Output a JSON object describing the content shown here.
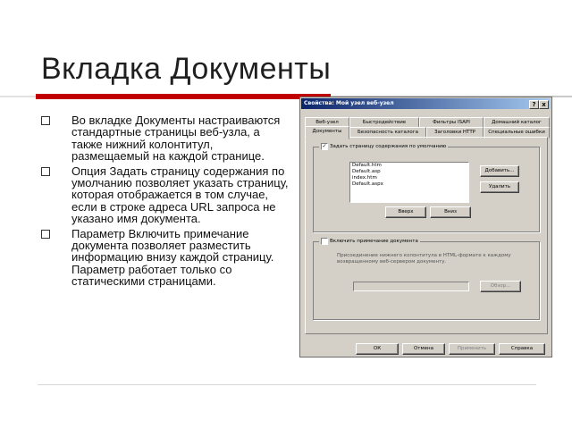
{
  "slide": {
    "title": "Вкладка Документы",
    "bullets": [
      "Во вкладке Документы настраиваются стандартные страницы веб-узла, а также нижний колонтитул, размещаемый на каждой странице.",
      "Опция Задать страницу содержания по умолчанию позволяет указать страницу, которая отображается в том случае, если в строке адреса URL запроса не указано имя документа.",
      "Параметр Включить примечание документа позволяет разместить информацию внизу каждой страницу. Параметр работает только со статическими страницами."
    ]
  },
  "dialog": {
    "title": "Свойства: Мой узел веб-узел",
    "help_glyph": "?",
    "close_glyph": "x",
    "tabs_row1": [
      "Веб-узел",
      "Быстродействие",
      "Фильтры ISAPI",
      "Домашний каталог"
    ],
    "tabs_row2": [
      "Документы",
      "Безопасность каталога",
      "Заголовки HTTP",
      "Специальные ошибки"
    ],
    "default_doc_label": "Задать страницу содержания по умолчанию",
    "default_docs": [
      "Default.htm",
      "Default.asp",
      "index.htm",
      "Default.aspx"
    ],
    "add_button": "Добавить...",
    "remove_button": "Удалить",
    "up_button": "Вверх",
    "down_button": "Вниз",
    "footer_label": "Включить примечание документа",
    "footer_desc": "Присоединение нижнего колонтитула в HTML-формате к каждому возвращенному веб-сервером документу.",
    "browse_button": "Обзор...",
    "ok_button": "ОК",
    "cancel_button": "Отмена",
    "apply_button": "Применить",
    "help_button": "Справка"
  }
}
